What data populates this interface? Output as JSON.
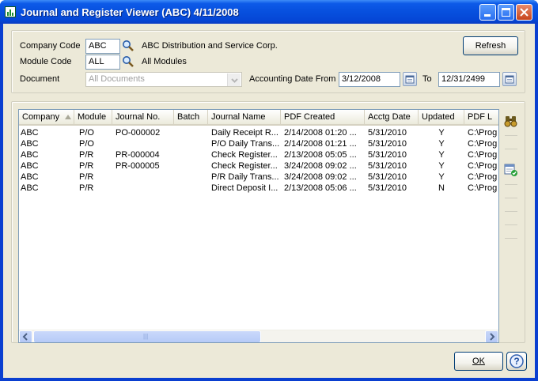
{
  "window": {
    "title": "Journal and Register Viewer (ABC) 4/11/2008",
    "buttons": [
      "minimize",
      "maximize",
      "close"
    ]
  },
  "filters": {
    "company_code_label": "Company Code",
    "company_code_value": "ABC",
    "company_name": "ABC Distribution and Service Corp.",
    "module_code_label": "Module Code",
    "module_code_value": "ALL",
    "module_name": "All Modules",
    "document_label": "Document",
    "document_value": "All Documents",
    "date_from_label": "Accounting Date From",
    "date_from_value": "3/12/2008",
    "date_to_label": "To",
    "date_to_value": "12/31/2499",
    "refresh_label": "Refresh"
  },
  "grid": {
    "columns": [
      "Company",
      "Module",
      "Journal No.",
      "Batch",
      "Journal Name",
      "PDF Created",
      "Acctg Date",
      "Updated",
      "PDF L"
    ],
    "rows": [
      [
        "ABC",
        "P/O",
        "PO-000002",
        "",
        "Daily Receipt R...",
        "2/14/2008 01:20 ...",
        "5/31/2010",
        "Y",
        "C:\\Prog"
      ],
      [
        "ABC",
        "P/O",
        "",
        "",
        "P/O Daily Trans...",
        "2/14/2008 01:21 ...",
        "5/31/2010",
        "Y",
        "C:\\Prog"
      ],
      [
        "ABC",
        "P/R",
        "PR-000004",
        "",
        "Check Register...",
        "2/13/2008 05:05 ...",
        "5/31/2010",
        "Y",
        "C:\\Prog"
      ],
      [
        "ABC",
        "P/R",
        "PR-000005",
        "",
        "Check Register...",
        "3/24/2008 09:02 ...",
        "5/31/2010",
        "Y",
        "C:\\Prog"
      ],
      [
        "ABC",
        "P/R",
        "",
        "",
        "P/R Daily Trans...",
        "3/24/2008 09:02 ...",
        "5/31/2010",
        "Y",
        "C:\\Prog"
      ],
      [
        "ABC",
        "P/R",
        "",
        "",
        "Direct Deposit I...",
        "2/13/2008 05:06 ...",
        "5/31/2010",
        "N",
        "C:\\Prog"
      ]
    ],
    "scroll_thumb_glyph": "|||"
  },
  "footer": {
    "ok_label": "OK",
    "help_label": "?"
  },
  "icons": {
    "app": "journal-viewer-icon",
    "lookup": "magnifier-icon",
    "calendar": "calendar-icon",
    "find": "binoculars-icon",
    "report": "report-check-icon"
  }
}
